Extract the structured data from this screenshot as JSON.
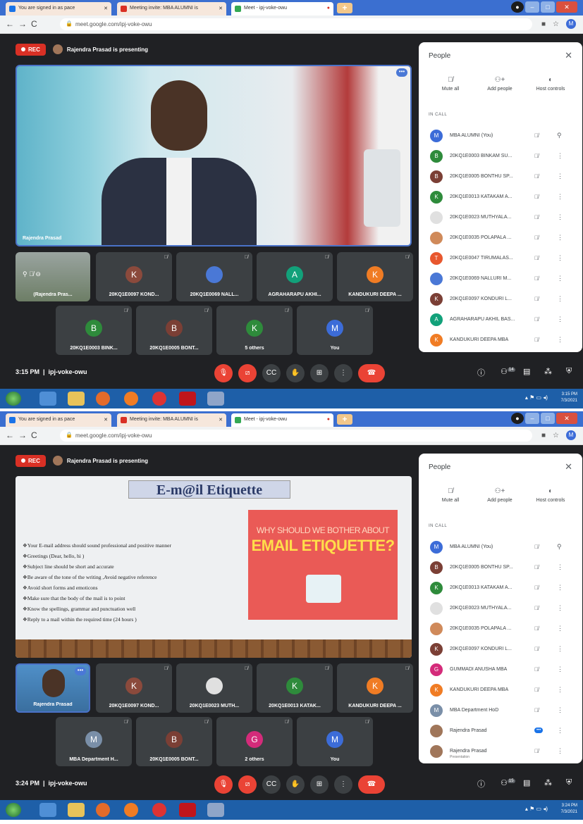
{
  "shots": [
    {
      "tabs": [
        {
          "label": "You are signed in as pace",
          "color": "#1a73e8"
        },
        {
          "label": "Meeting invite: MBA ALUMNI is",
          "color": "#d93025"
        },
        {
          "label": "Meet - ipj-voke-owu",
          "color": "#34a853"
        }
      ],
      "url": "meet.google.com/ipj-voke-owu",
      "rec": "REC",
      "presenting": "Rajendra Prasad is presenting",
      "main_label": "Rajendra Prasad",
      "small_preview_label": "(Rajendra Pras...",
      "tiles_row1": [
        {
          "name": "20KQ1E0097 KOND...",
          "initial": "K",
          "color": "#8b4a3c"
        },
        {
          "name": "20KQ1E0069 NALL...",
          "initial": "",
          "color": "#4a78d6"
        },
        {
          "name": "AGRAHARAPU AKHI...",
          "initial": "A",
          "color": "#12a17a"
        },
        {
          "name": "KANDUKURI DEEPA ...",
          "initial": "K",
          "color": "#f07c24"
        }
      ],
      "tiles_row2": [
        {
          "name": "20KQ1E0003 BINK...",
          "initial": "B",
          "color": "#2e8b3b"
        },
        {
          "name": "20KQ1E0005 BONT...",
          "initial": "B",
          "color": "#7b3f35"
        },
        {
          "name": "5 others",
          "initial": "K",
          "color": "#2e8b3b"
        },
        {
          "name": "You",
          "initial": "M",
          "color": "#3c6cd8"
        }
      ],
      "time": "3:15 PM",
      "code": "ipj-voke-owu",
      "people_title": "People",
      "actions": [
        "Mute all",
        "Add people",
        "Host controls"
      ],
      "in_call": "IN CALL",
      "participants": [
        {
          "name": "MBA ALUMNI (You)",
          "initial": "M",
          "color": "#3c6cd8",
          "pin": true
        },
        {
          "name": "20KQ1E0003 BINKAM SU...",
          "initial": "B",
          "color": "#2e8b3b"
        },
        {
          "name": "20KQ1E0005 BONTHU SP...",
          "initial": "B",
          "color": "#7b3f35"
        },
        {
          "name": "20KQ1E0013 KATAKAM A...",
          "initial": "K",
          "color": "#2e8b3b"
        },
        {
          "name": "20KQ1E0023 MUTHYALA...",
          "initial": "",
          "color": "#e0e0e0"
        },
        {
          "name": "20KQ1E0035 POLAPALA ...",
          "initial": "",
          "color": "#d08a5a"
        },
        {
          "name": "20KQ1E0047 TIRUMALAS...",
          "initial": "T",
          "color": "#e8572e"
        },
        {
          "name": "20KQ1E0069 NALLURI M...",
          "initial": "",
          "color": "#4a78d6"
        },
        {
          "name": "20KQ1E0097 KONDURI L...",
          "initial": "K",
          "color": "#7b3f35"
        },
        {
          "name": "AGRAHARAPU AKHIL BAS...",
          "initial": "A",
          "color": "#12a17a"
        },
        {
          "name": "KANDUKURI DEEPA MBA",
          "initial": "K",
          "color": "#f07c24"
        }
      ],
      "badge": "14",
      "taskbar_time": "3:15 PM",
      "taskbar_date": "7/3/2021"
    },
    {
      "tabs": [
        {
          "label": "You are signed in as pace",
          "color": "#1a73e8"
        },
        {
          "label": "Meeting invite: MBA ALUMNI is",
          "color": "#d93025"
        },
        {
          "label": "Meet - ipj-voke-owu",
          "color": "#34a853"
        }
      ],
      "url": "meet.google.com/ipj-voke-owu",
      "rec": "REC",
      "presenting": "Rajendra Prasad is presenting",
      "slide": {
        "title": "E-m@il Etiquette",
        "bullets": [
          "Your E-mail address should sound professional and positive manner",
          "Greetings (Dear, hello, hi )",
          "Subject line should be short and accurate",
          "Be aware of the tone of the writing ,Avoid negative reference",
          "Avoid short forms and emoticons",
          "Make sure that the body of the mail is to point",
          "Know the spellings, grammar and punctuation well",
          "Reply to a mail within the required time (24 hours )"
        ],
        "box_line1": "WHY SHOULD WE BOTHER ABOUT",
        "box_line2": "EMAIL ETIQUETTE?"
      },
      "self_tile": "Rajendra Prasad",
      "tiles_row1": [
        {
          "name": "20KQ1E0097 KOND...",
          "initial": "K",
          "color": "#8b4a3c"
        },
        {
          "name": "20KQ1E0023 MUTH...",
          "initial": "",
          "color": "#e0e0e0"
        },
        {
          "name": "20KQ1E0013 KATAK...",
          "initial": "K",
          "color": "#2e8b3b"
        },
        {
          "name": "KANDUKURI DEEPA ...",
          "initial": "K",
          "color": "#f07c24"
        }
      ],
      "tiles_row2": [
        {
          "name": "MBA Department H...",
          "initial": "M",
          "color": "#7a8fa8"
        },
        {
          "name": "20KQ1E0005 BONT...",
          "initial": "B",
          "color": "#7b3f35"
        },
        {
          "name": "2 others",
          "initial": "G",
          "color": "#d42b7a"
        },
        {
          "name": "You",
          "initial": "M",
          "color": "#3c6cd8"
        }
      ],
      "time": "3:24 PM",
      "code": "ipj-voke-owu",
      "people_title": "People",
      "actions": [
        "Mute all",
        "Add people",
        "Host controls"
      ],
      "in_call": "IN CALL",
      "participants": [
        {
          "name": "MBA ALUMNI (You)",
          "initial": "M",
          "color": "#3c6cd8",
          "pin": true
        },
        {
          "name": "20KQ1E0005 BONTHU SP...",
          "initial": "B",
          "color": "#7b3f35"
        },
        {
          "name": "20KQ1E0013 KATAKAM A...",
          "initial": "K",
          "color": "#2e8b3b"
        },
        {
          "name": "20KQ1E0023 MUTHYALA...",
          "initial": "",
          "color": "#e0e0e0"
        },
        {
          "name": "20KQ1E0035 POLAPALA ...",
          "initial": "",
          "color": "#d08a5a"
        },
        {
          "name": "20KQ1E0097 KONDURI L...",
          "initial": "K",
          "color": "#7b3f35"
        },
        {
          "name": "GUMMADI ANUSHA MBA",
          "initial": "G",
          "color": "#d42b7a"
        },
        {
          "name": "KANDUKURI DEEPA MBA",
          "initial": "K",
          "color": "#f07c24"
        },
        {
          "name": "MBA Department HoD",
          "initial": "M",
          "color": "#7a8fa8"
        },
        {
          "name": "Rajendra Prasad",
          "initial": "",
          "color": "#a0765a",
          "dots": true
        },
        {
          "name": "Rajendra Prasad",
          "sub": "Presentation",
          "initial": "",
          "color": "#a0765a"
        }
      ],
      "badge": "15",
      "taskbar_time": "3:24 PM",
      "taskbar_date": "7/3/2021"
    }
  ]
}
